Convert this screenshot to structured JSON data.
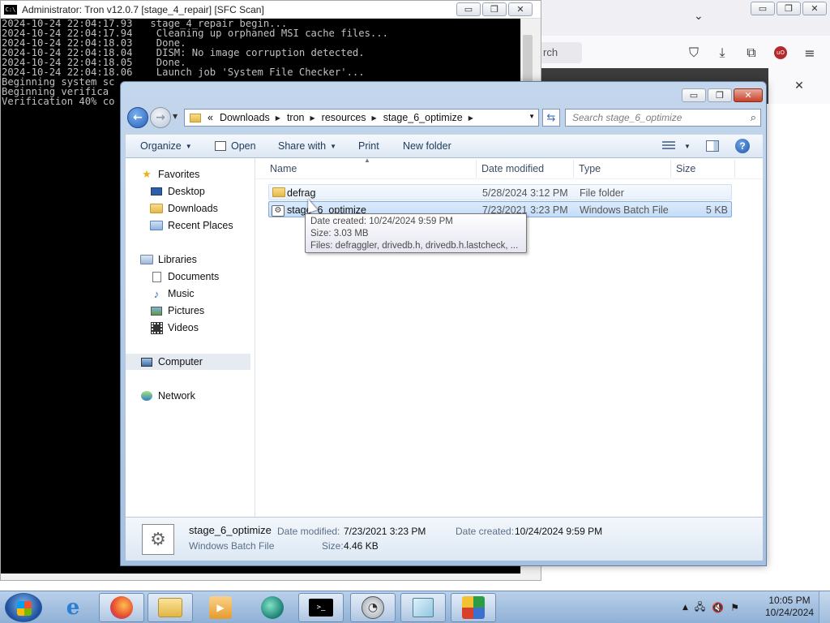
{
  "console": {
    "title": "Administrator:  Tron v12.0.7 [stage_4_repair] [SFC Scan]",
    "lines": [
      "2024-10-24 22:04:17.93   stage_4_repair begin...",
      "2024-10-24 22:04:17.94    Cleaning up orphaned MSI cache files...",
      "2024-10-24 22:04:18.03    Done.",
      "2024-10-24 22:04:18.04    DISM: No image corruption detected.",
      "2024-10-24 22:04:18.05    Done.",
      "2024-10-24 22:04:18.06    Launch job 'System File Checker'...",
      "",
      "Beginning system sc",
      "",
      "Beginning verifica",
      "Verification 40% co"
    ]
  },
  "browser": {
    "search_fragment": "rch"
  },
  "explorer": {
    "breadcrumb": [
      "Downloads",
      "tron",
      "resources",
      "stage_6_optimize"
    ],
    "breadcrumb_overflow": "«",
    "search_placeholder": "Search stage_6_optimize",
    "toolbar": {
      "organize": "Organize",
      "open": "Open",
      "share_with": "Share with",
      "print": "Print",
      "new_folder": "New folder"
    },
    "nav": {
      "favorites": "Favorites",
      "desktop": "Desktop",
      "downloads": "Downloads",
      "recent_places": "Recent Places",
      "libraries": "Libraries",
      "documents": "Documents",
      "music": "Music",
      "pictures": "Pictures",
      "videos": "Videos",
      "computer": "Computer",
      "network": "Network"
    },
    "columns": {
      "name": "Name",
      "date_modified": "Date modified",
      "type": "Type",
      "size": "Size"
    },
    "files": [
      {
        "name": "defrag",
        "date": "5/28/2024 3:12 PM",
        "type": "File folder",
        "size": ""
      },
      {
        "name": "stage_6_optimize",
        "date": "7/23/2021 3:23 PM",
        "type": "Windows Batch File",
        "size": "5 KB"
      }
    ],
    "tooltip": {
      "date_created": "Date created: 10/24/2024 9:59 PM",
      "size": "Size: 3.03 MB",
      "files": "Files: defraggler, drivedb.h, drivedb.h.lastcheck, ..."
    },
    "details": {
      "name": "stage_6_optimize",
      "type": "Windows Batch File",
      "date_modified_label": "Date modified:",
      "date_modified": "7/23/2021 3:23 PM",
      "date_created_label": "Date created:",
      "date_created": "10/24/2024 9:59 PM",
      "size_label": "Size:",
      "size": "4.46 KB"
    }
  },
  "taskbar": {
    "time": "10:05 PM",
    "date": "10/24/2024"
  }
}
